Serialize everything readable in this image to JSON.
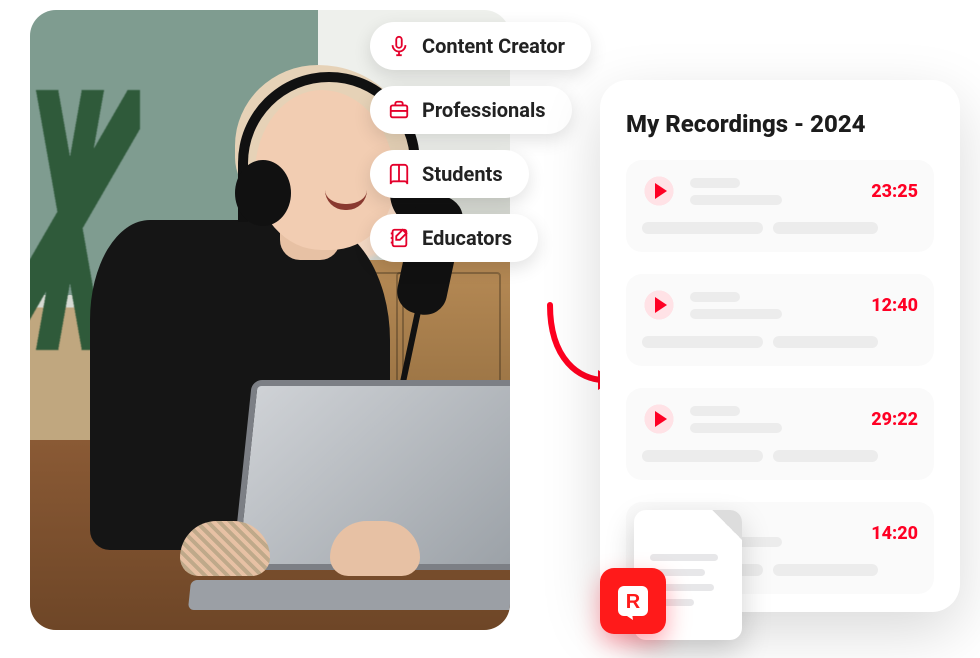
{
  "categories": [
    {
      "icon": "microphone-icon",
      "label": "Content Creator"
    },
    {
      "icon": "briefcase-icon",
      "label": "Professionals"
    },
    {
      "icon": "book-icon",
      "label": "Students"
    },
    {
      "icon": "notebook-icon",
      "label": "Educators"
    }
  ],
  "panel": {
    "title": "My Recordings - 2024",
    "recordings": [
      {
        "duration": "23:25"
      },
      {
        "duration": "12:40"
      },
      {
        "duration": "29:22"
      },
      {
        "duration": "14:20"
      }
    ]
  },
  "brand": {
    "letter": "R"
  }
}
